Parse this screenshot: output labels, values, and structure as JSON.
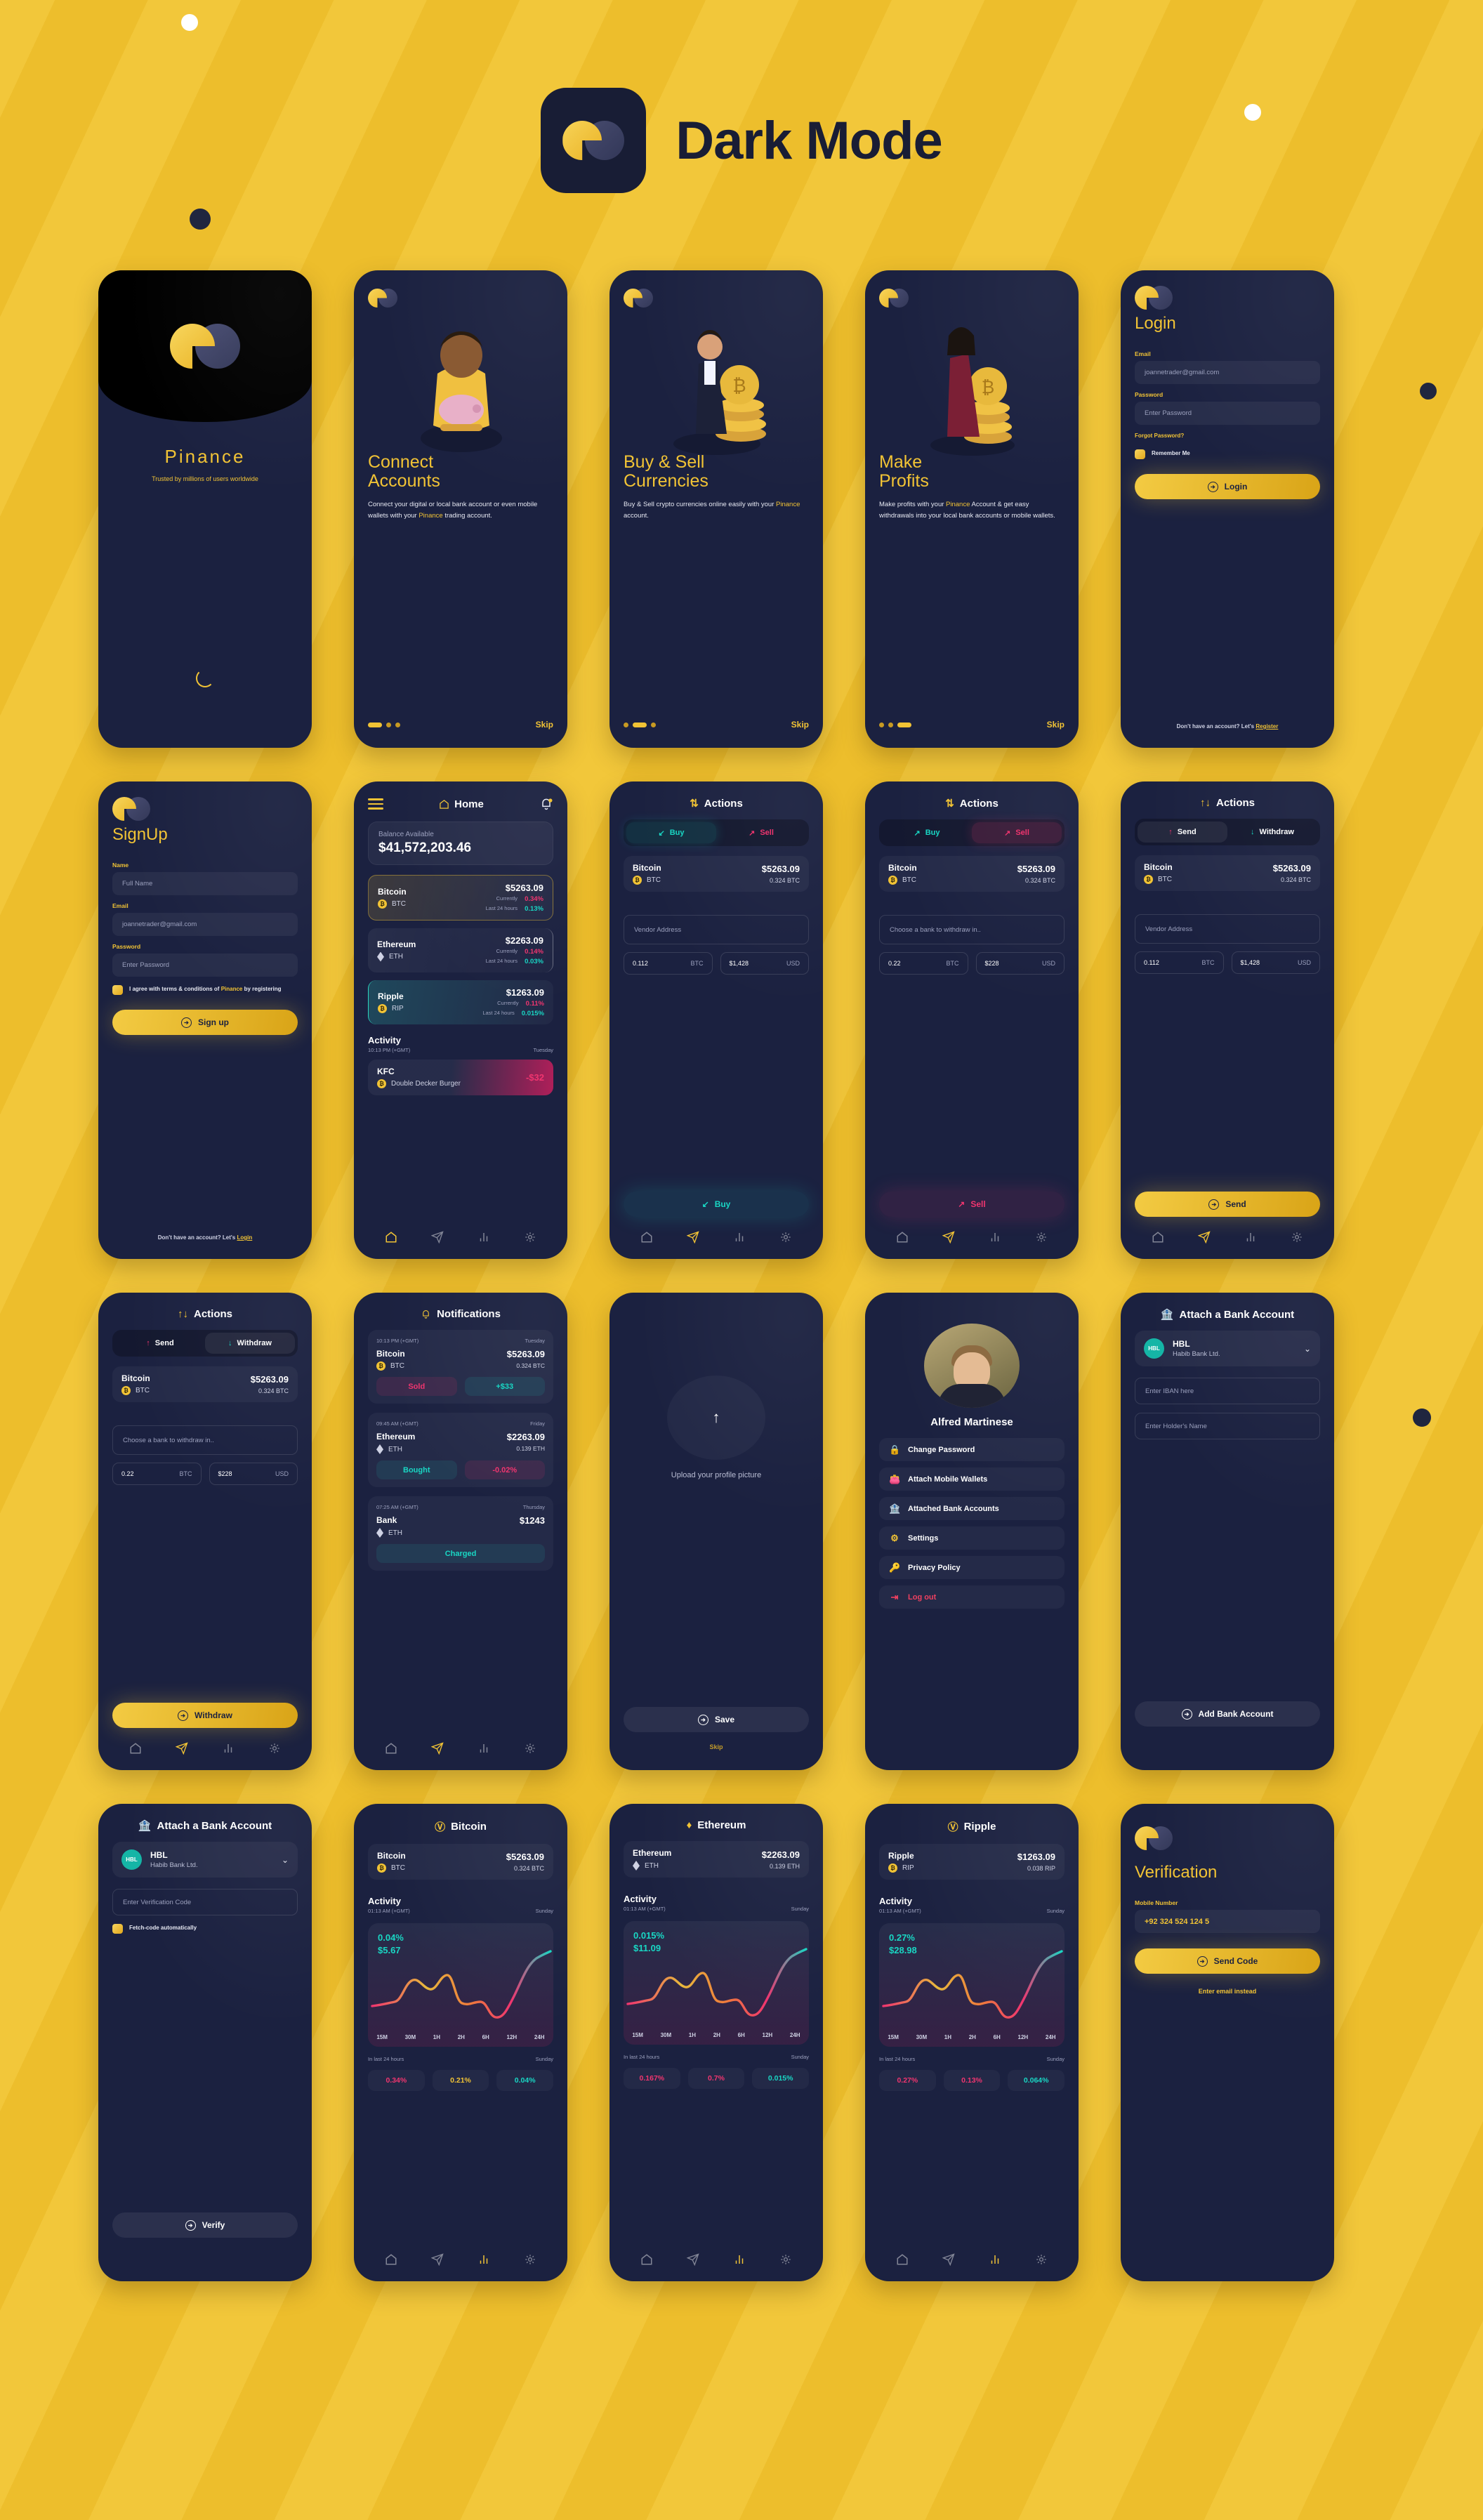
{
  "header": {
    "title": "Dark Mode",
    "logo_icon": "pinance-logo-icon"
  },
  "splash": {
    "brand": "Pinance",
    "tagline": "Trusted by millions of users worldwide"
  },
  "onboarding": [
    {
      "title_line1": "Connect",
      "title_line2": "Accounts",
      "body_before": "Connect your digital or local bank account or even mobile wallets with your ",
      "body_brand": "Pinance",
      "body_after": " trading account.",
      "skip": "Skip",
      "active_dot": 0
    },
    {
      "title_line1": "Buy & Sell",
      "title_line2": "Currencies",
      "body_before": "Buy & Sell crypto currencies online easily with your ",
      "body_brand": "Pinance",
      "body_after": " account.",
      "skip": "Skip",
      "active_dot": 1
    },
    {
      "title_line1": "Make",
      "title_line2": "Profits",
      "body_before": "Make profits with your ",
      "body_brand": "Pinance",
      "body_after": " Account & get easy withdrawals into your local bank accounts or mobile wallets.",
      "skip": "Skip",
      "active_dot": 2
    }
  ],
  "login": {
    "title": "Login",
    "email_label": "Email",
    "email_placeholder": "joannetrader@gmail.com",
    "password_label": "Password",
    "password_placeholder": "Enter Password",
    "forgot": "Forgot Password?",
    "remember": "Remember Me",
    "button": "Login",
    "footer_text": "Don't have an account? Let's ",
    "footer_link": "Register"
  },
  "signup": {
    "title": "SignUp",
    "name_label": "Name",
    "name_placeholder": "Full Name",
    "email_label": "Email",
    "email_placeholder": "joannetrader@gmail.com",
    "password_label": "Password",
    "password_placeholder": "Enter Password",
    "terms_before": "I agree with terms & conditions of ",
    "terms_brand": "Pinance",
    "terms_after": " by registering",
    "button": "Sign up",
    "footer_text": "Don't have an account? Let's ",
    "footer_link": "Login"
  },
  "home": {
    "title": "Home",
    "balance_label": "Balance Available",
    "balance_value": "$41,572,203.46",
    "coins": [
      {
        "name": "Bitcoin",
        "symbol": "BTC",
        "price": "$5263.09",
        "currently_label": "Currently",
        "currently": "0.34%",
        "last24_label": "Last 24 hours",
        "last24": "0.13%"
      },
      {
        "name": "Ethereum",
        "symbol": "ETH",
        "price": "$2263.09",
        "currently_label": "Currently",
        "currently": "0.14%",
        "last24_label": "Last 24 hours",
        "last24": "0.03%"
      },
      {
        "name": "Ripple",
        "symbol": "RIP",
        "price": "$1263.09",
        "currently_label": "Currently",
        "currently": "0.11%",
        "last24_label": "Last 24 hours",
        "last24": "0.015%"
      }
    ],
    "activity_title": "Activity",
    "activity_time": "10:13 PM (+GMT)",
    "activity_day": "Tuesday",
    "txn": {
      "merchant": "KFC",
      "detail": "Double Decker Burger",
      "amount": "-$32"
    }
  },
  "actions_buy": {
    "title": "Actions",
    "tab_buy": "Buy",
    "tab_sell": "Sell",
    "coin": {
      "name": "Bitcoin",
      "symbol": "BTC",
      "price": "$5263.09",
      "holding": "0.324 BTC"
    },
    "address_placeholder": "Vendor Address",
    "amount_crypto": "0.112",
    "amount_crypto_unit": "BTC",
    "amount_fiat": "$1,428",
    "amount_fiat_unit": "USD",
    "cta": "Buy"
  },
  "actions_sell": {
    "title": "Actions",
    "tab_buy": "Buy",
    "tab_sell": "Sell",
    "coin": {
      "name": "Bitcoin",
      "symbol": "BTC",
      "price": "$5263.09",
      "holding": "0.324 BTC"
    },
    "address_placeholder": "Choose a bank to withdraw in..",
    "amount_crypto": "0.22",
    "amount_crypto_unit": "BTC",
    "amount_fiat": "$228",
    "amount_fiat_unit": "USD",
    "cta": "Sell"
  },
  "actions_send": {
    "title": "Actions",
    "tab_send": "Send",
    "tab_withdraw": "Withdraw",
    "coin": {
      "name": "Bitcoin",
      "symbol": "BTC",
      "price": "$5263.09",
      "holding": "0.324 BTC"
    },
    "address_placeholder": "Vendor Address",
    "amount_crypto": "0.112",
    "amount_crypto_unit": "BTC",
    "amount_fiat": "$1,428",
    "amount_fiat_unit": "USD",
    "cta": "Send"
  },
  "actions_withdraw": {
    "title": "Actions",
    "tab_send": "Send",
    "tab_withdraw": "Withdraw",
    "coin": {
      "name": "Bitcoin",
      "symbol": "BTC",
      "price": "$5263.09",
      "holding": "0.324 BTC"
    },
    "address_placeholder": "Choose a bank to withdraw in..",
    "amount_crypto": "0.22",
    "amount_crypto_unit": "BTC",
    "amount_fiat": "$228",
    "amount_fiat_unit": "USD",
    "cta": "Withdraw"
  },
  "notifications": {
    "title": "Notifications",
    "items": [
      {
        "time": "10:13 PM (+GMT)",
        "day": "Tuesday",
        "name": "Bitcoin",
        "symbol": "BTC",
        "price": "$5263.09",
        "holding": "0.324 BTC",
        "pill1": "Sold",
        "pill2": "+$33"
      },
      {
        "time": "09:45 AM (+GMT)",
        "day": "Friday",
        "name": "Ethereum",
        "symbol": "ETH",
        "price": "$2263.09",
        "holding": "0.139 ETH",
        "pill1": "Bought",
        "pill2": "-0.02%"
      },
      {
        "time": "07:25 AM (+GMT)",
        "day": "Thursday",
        "name": "Bank",
        "symbol": "ETH",
        "price": "$1243",
        "holding": "",
        "pill1": "Charged",
        "pill2": ""
      }
    ]
  },
  "upload": {
    "prompt": "Upload your profile picture",
    "save": "Save",
    "skip": "Skip"
  },
  "profile": {
    "name": "Alfred Martinese",
    "items": [
      {
        "label": "Change Password",
        "icon": "lock-icon"
      },
      {
        "label": "Attach Mobile Wallets",
        "icon": "wallet-icon"
      },
      {
        "label": "Attached Bank Accounts",
        "icon": "bank-icon"
      },
      {
        "label": "Settings",
        "icon": "gear-icon"
      },
      {
        "label": "Privacy Policy",
        "icon": "key-icon"
      },
      {
        "label": "Log out",
        "icon": "logout-icon"
      }
    ]
  },
  "attach_bank": {
    "title": "Attach a Bank Account",
    "bank_code": "HBL",
    "bank_name": "HBL",
    "bank_full": "Habib Bank Ltd.",
    "iban_placeholder": "Enter IBAN here",
    "holder_placeholder": "Enter Holder's Name",
    "cta": "Add Bank Account"
  },
  "attach_bank_verify": {
    "title": "Attach a Bank Account",
    "bank_code": "HBL",
    "bank_name": "HBL",
    "bank_full": "Habib Bank Ltd.",
    "code_placeholder": "Enter Verification Code",
    "fetch_label": "Fetch-code automatically",
    "cta": "Verify"
  },
  "verification": {
    "title": "Verification",
    "mobile_label": "Mobile Number",
    "mobile_value": "+92 324 524 124 5",
    "cta": "Send Code",
    "alt": "Enter email instead"
  },
  "chart_screens": [
    {
      "title": "Bitcoin",
      "icon": "bitcoin-icon",
      "coin": {
        "name": "Bitcoin",
        "symbol": "BTC",
        "price": "$5263.09",
        "holding": "0.324 BTC"
      },
      "activity_title": "Activity",
      "activity_time": "01:13 AM (+GMT)",
      "activity_day": "Sunday",
      "in_last": "In last 24 hours",
      "in_last_day": "Sunday",
      "stats": [
        "0.34%",
        "0.21%",
        "0.04%"
      ]
    },
    {
      "title": "Ethereum",
      "icon": "ethereum-icon",
      "coin": {
        "name": "Ethereum",
        "symbol": "ETH",
        "price": "$2263.09",
        "holding": "0.139 ETH"
      },
      "activity_title": "Activity",
      "activity_time": "01:13 AM (+GMT)",
      "activity_day": "Sunday",
      "in_last": "In last 24 hours",
      "in_last_day": "Sunday",
      "stats": [
        "0.167%",
        "0.7%",
        "0.015%"
      ]
    },
    {
      "title": "Ripple",
      "icon": "ripple-icon",
      "coin": {
        "name": "Ripple",
        "symbol": "RIP",
        "price": "$1263.09",
        "holding": "0.038 RIP"
      },
      "activity_title": "Activity",
      "activity_time": "01:13 AM (+GMT)",
      "activity_day": "Sunday",
      "in_last": "In last 24 hours",
      "in_last_day": "Sunday",
      "stats": [
        "0.27%",
        "0.13%",
        "0.064%"
      ]
    }
  ],
  "chart_data": [
    {
      "type": "line",
      "title": "Bitcoin",
      "change_percent": "0.04%",
      "change_value": "$5.67",
      "x": [
        "15M",
        "30M",
        "1H",
        "2H",
        "6H",
        "12H",
        "24H"
      ],
      "ticklabels": [
        "15M",
        "30M",
        "1H",
        "2H",
        "6H",
        "12H",
        "24H"
      ],
      "values": [
        18,
        22,
        46,
        38,
        52,
        20,
        16,
        10,
        66,
        92
      ],
      "ylabel": "",
      "xlabel": "",
      "grid": false,
      "legend": "none"
    },
    {
      "type": "line",
      "title": "Ethereum",
      "change_percent": "0.015%",
      "change_value": "$11.09",
      "x": [
        "15M",
        "30M",
        "1H",
        "2H",
        "6H",
        "12H",
        "24H"
      ],
      "ticklabels": [
        "15M",
        "30M",
        "1H",
        "2H",
        "6H",
        "12H",
        "24H"
      ],
      "values": [
        18,
        22,
        46,
        38,
        52,
        20,
        16,
        10,
        66,
        92
      ],
      "ylabel": "",
      "xlabel": "",
      "grid": false,
      "legend": "none"
    },
    {
      "type": "line",
      "title": "Ripple",
      "change_percent": "0.27%",
      "change_value": "$28.98",
      "x": [
        "15M",
        "30M",
        "1H",
        "2H",
        "6H",
        "12H",
        "24H"
      ],
      "ticklabels": [
        "15M",
        "30M",
        "1H",
        "2H",
        "6H",
        "12H",
        "24H"
      ],
      "values": [
        18,
        22,
        46,
        38,
        52,
        20,
        16,
        10,
        66,
        92
      ],
      "ylabel": "",
      "xlabel": "",
      "grid": false,
      "legend": "none"
    }
  ],
  "colors": {
    "background": "#f0c233",
    "surface": "#1b2140",
    "accent": "#f1c335",
    "pink": "#f0356f",
    "teal": "#19d7c4",
    "dark": "#191d35"
  }
}
